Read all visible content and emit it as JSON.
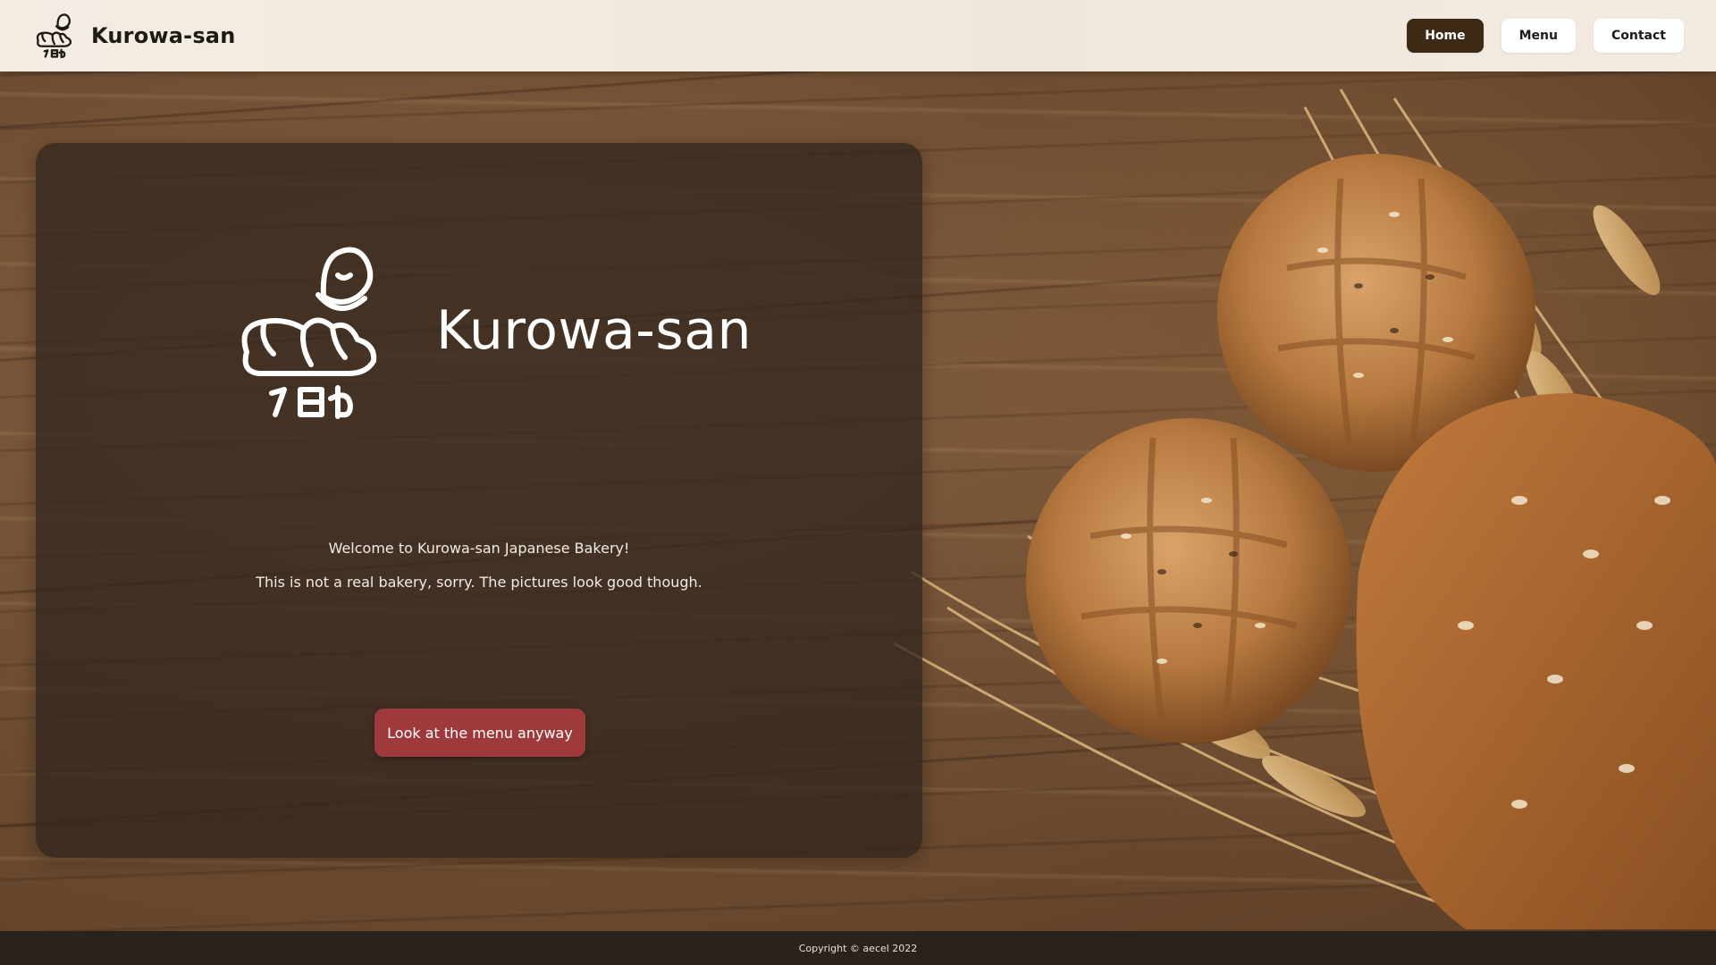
{
  "header": {
    "brand_name": "Kurowa-san",
    "logo_icon": "croissant-top-hat-logo",
    "nav": [
      {
        "label": "Home",
        "active": true
      },
      {
        "label": "Menu",
        "active": false
      },
      {
        "label": "Contact",
        "active": false
      }
    ]
  },
  "hero": {
    "logo_icon": "croissant-top-hat-logo",
    "logo_text": "クロわ",
    "title": "Kurowa-san",
    "welcome": "Welcome to Kurowa-san Japanese Bakery!",
    "subtitle": "This is not a real bakery, sorry. The pictures look good though.",
    "cta_label": "Look at the menu anyway"
  },
  "background": {
    "image": "wooden-table-with-bread-loaves-and-wheat"
  },
  "footer": {
    "copyright": "Copyright © aecel 2022"
  },
  "colors": {
    "header_bg": "#f3ede4",
    "nav_active": "#3c2a14",
    "panel_bg": "rgba(50,38,30,0.78)",
    "cta": "#9e3a3c",
    "footer_bg": "#2a221d"
  }
}
